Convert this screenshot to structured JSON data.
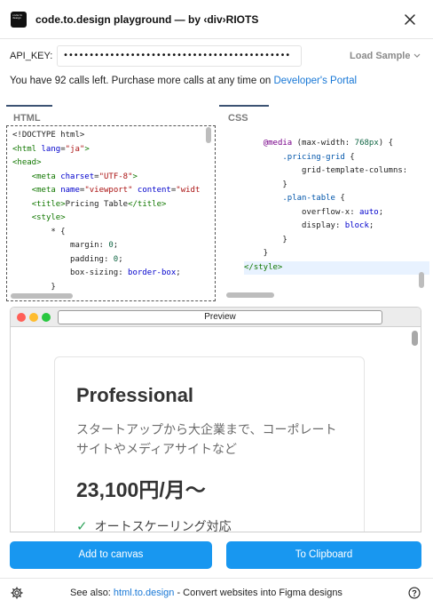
{
  "window": {
    "title": "code.to.design playground — by ‹div›RIOTS",
    "logo_text": "code to design"
  },
  "api": {
    "label": "API_KEY:",
    "value": "••••••••••••••••••••••••••••••••••••••••••••",
    "load_sample": "Load Sample"
  },
  "calls": {
    "text": "You have 92 calls left. Purchase more calls at any time on ",
    "link": "Developer's Portal"
  },
  "tabs": {
    "html": "HTML",
    "css": "CSS"
  },
  "html_code": [
    [
      {
        "t": "<!DOCTYPE html>",
        "c": ""
      }
    ],
    [
      {
        "t": "<html ",
        "c": "tag"
      },
      {
        "t": "lang",
        "c": "attr"
      },
      {
        "t": "=",
        "c": ""
      },
      {
        "t": "\"ja\"",
        "c": "str"
      },
      {
        "t": ">",
        "c": "tag"
      }
    ],
    [
      {
        "t": "<head>",
        "c": "tag"
      }
    ],
    [
      {
        "t": "    ",
        "c": ""
      },
      {
        "t": "<meta ",
        "c": "tag"
      },
      {
        "t": "charset",
        "c": "attr"
      },
      {
        "t": "=",
        "c": ""
      },
      {
        "t": "\"UTF-8\"",
        "c": "str"
      },
      {
        "t": ">",
        "c": "tag"
      }
    ],
    [
      {
        "t": "    ",
        "c": ""
      },
      {
        "t": "<meta ",
        "c": "tag"
      },
      {
        "t": "name",
        "c": "attr"
      },
      {
        "t": "=",
        "c": ""
      },
      {
        "t": "\"viewport\"",
        "c": "str"
      },
      {
        "t": " ",
        "c": ""
      },
      {
        "t": "content",
        "c": "attr"
      },
      {
        "t": "=",
        "c": ""
      },
      {
        "t": "\"widt",
        "c": "str"
      }
    ],
    [
      {
        "t": "    ",
        "c": ""
      },
      {
        "t": "<title>",
        "c": "tag"
      },
      {
        "t": "Pricing Table",
        "c": ""
      },
      {
        "t": "</title>",
        "c": "tag"
      }
    ],
    [
      {
        "t": "    ",
        "c": ""
      },
      {
        "t": "<style>",
        "c": "tag"
      }
    ],
    [
      {
        "t": "        * {",
        "c": ""
      }
    ],
    [
      {
        "t": "            margin: ",
        "c": ""
      },
      {
        "t": "0",
        "c": "num"
      },
      {
        "t": ";",
        "c": ""
      }
    ],
    [
      {
        "t": "            padding: ",
        "c": ""
      },
      {
        "t": "0",
        "c": "num"
      },
      {
        "t": ";",
        "c": ""
      }
    ],
    [
      {
        "t": "            box-sizing: ",
        "c": ""
      },
      {
        "t": "border-box",
        "c": "attr"
      },
      {
        "t": ";",
        "c": ""
      }
    ],
    [
      {
        "t": "        }",
        "c": ""
      }
    ]
  ],
  "css_code": [
    [
      {
        "t": "    ",
        "c": ""
      },
      {
        "t": "@media",
        "c": "at"
      },
      {
        "t": " (max-width: ",
        "c": ""
      },
      {
        "t": "768px",
        "c": "num"
      },
      {
        "t": ") {",
        "c": ""
      }
    ],
    [
      {
        "t": "        ",
        "c": ""
      },
      {
        "t": ".pricing-grid",
        "c": "sel"
      },
      {
        "t": " {",
        "c": ""
      }
    ],
    [
      {
        "t": "            grid-template-columns:",
        "c": ""
      }
    ],
    [
      {
        "t": "        }",
        "c": ""
      }
    ],
    [
      {
        "t": "",
        "c": ""
      }
    ],
    [
      {
        "t": "        ",
        "c": ""
      },
      {
        "t": ".plan-table",
        "c": "sel"
      },
      {
        "t": " {",
        "c": ""
      }
    ],
    [
      {
        "t": "            overflow-x: ",
        "c": ""
      },
      {
        "t": "auto",
        "c": "attr"
      },
      {
        "t": ";",
        "c": ""
      }
    ],
    [
      {
        "t": "            display: ",
        "c": ""
      },
      {
        "t": "block",
        "c": "attr"
      },
      {
        "t": ";",
        "c": ""
      }
    ],
    [
      {
        "t": "        }",
        "c": ""
      }
    ],
    [
      {
        "t": "    }",
        "c": ""
      }
    ],
    [
      {
        "t": "</style>",
        "c": "tag"
      }
    ]
  ],
  "preview": {
    "label": "Preview",
    "plan_name": "Professional",
    "plan_desc": "スタートアップから大企業まで、コーポレートサイトやメディアサイトなど",
    "plan_price": "23,100円/月〜",
    "feature": "オートスケーリング対応",
    "feature_icon": "check-icon"
  },
  "buttons": {
    "add_canvas": "Add to canvas",
    "clipboard": "To Clipboard"
  },
  "footer": {
    "see_also": "See also: ",
    "link": "html.to.design",
    "rest": " - Convert websites into Figma designs"
  },
  "colors": {
    "accent": "#1897f0",
    "link": "#1777d6",
    "check": "#2ea35a"
  }
}
